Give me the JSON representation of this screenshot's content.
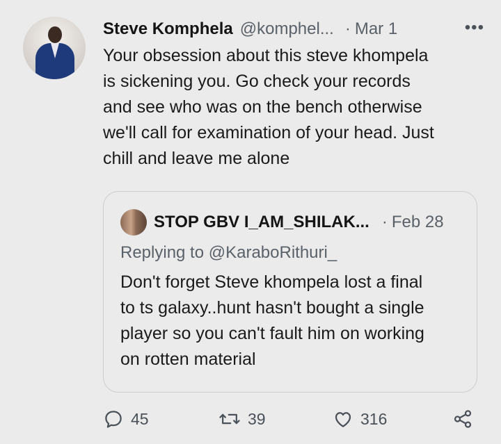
{
  "tweet": {
    "author_name": "Steve Komphela",
    "author_handle": "@komphel...",
    "separator": "·",
    "date": "Mar 1",
    "more_label": "•••",
    "text": "Your obsession about this steve khompela\nis sickening you. Go check your records\nand see who was on the bench otherwise\nwe'll call for examination of your head. Just\nchill and leave me alone"
  },
  "quoted_tweet": {
    "author_name": "STOP GBV I_AM_SHILAK...",
    "separator": "·",
    "date": "Feb 28",
    "replying_to": "Replying to @KaraboRithuri_",
    "text": "Don't forget Steve khompela lost a final\nto ts galaxy..hunt hasn't bought a single\nplayer so you can't fault him on working\non rotten material"
  },
  "actions": {
    "replies": "45",
    "retweets": "39",
    "likes": "316"
  },
  "icons": {
    "reply": "reply-icon",
    "retweet": "retweet-icon",
    "like": "heart-icon",
    "share": "share-icon"
  },
  "colors": {
    "background": "#ebebeb",
    "text": "#1a1a1a",
    "secondary_text": "#5a6168",
    "border": "#c8cdd2"
  }
}
